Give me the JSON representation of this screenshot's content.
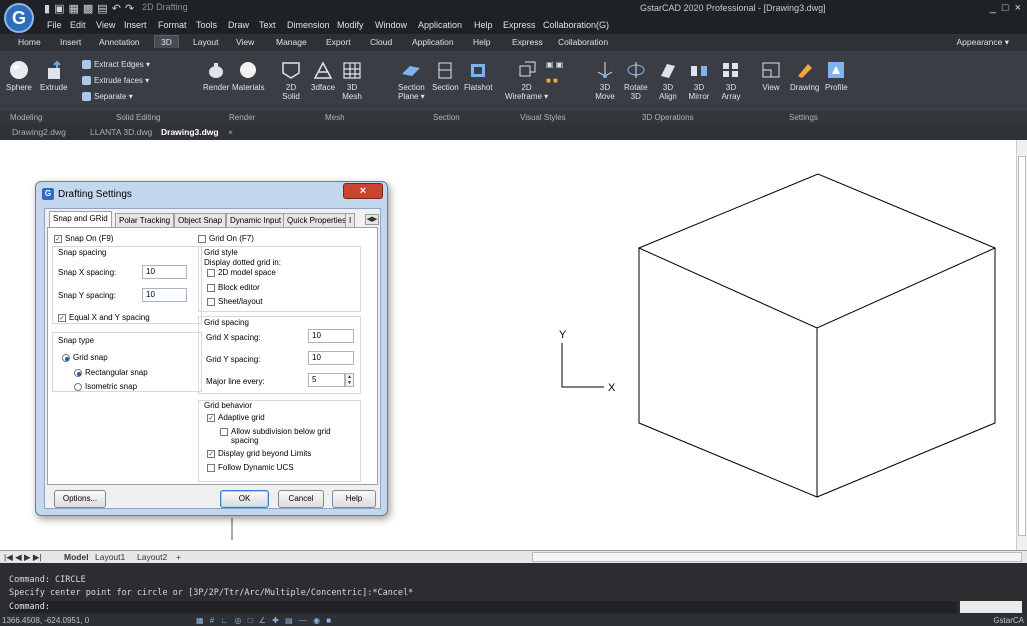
{
  "app": {
    "logo_letter": "G",
    "window_title": "GstarCAD 2020 Professional - [Drawing3.dwg]",
    "quick_access_label": "2D Drafting",
    "controls": [
      "_",
      "□",
      "×"
    ]
  },
  "menu": [
    "File",
    "Edit",
    "View",
    "Insert",
    "Format",
    "Tools",
    "Draw",
    "Text",
    "Dimension",
    "Modify",
    "Window",
    "Application",
    "Help",
    "Express",
    "Collaboration(G)"
  ],
  "ribbon_tabs": [
    "Home",
    "Insert",
    "Annotation",
    "3D",
    "Layout",
    "View",
    "Manage",
    "Export",
    "Cloud",
    "Application",
    "Help",
    "Express",
    "Collaboration"
  ],
  "active_ribbon_tab": "3D",
  "appearance_label": "Appearance ▾",
  "ribbon": {
    "modeling": {
      "sphere": "Sphere",
      "extrude": "Extrude",
      "label": "Modeling"
    },
    "solid_editing": {
      "extract_edges": "Extract Edges ▾",
      "extrude_faces": "Extrude faces ▾",
      "separate": "Separate ▾",
      "label": "Solid Editing"
    },
    "render": {
      "render": "Render",
      "materials": "Materials",
      "label": "Render"
    },
    "mesh": {
      "solid_2d_a": "2D",
      "solid_2d_b": "Solid",
      "3dface": "3dface",
      "mesh_a": "3D",
      "mesh_b": "Mesh",
      "label": "Mesh"
    },
    "section": {
      "section_plane_a": "Section",
      "section_plane_b": "Plane ▾",
      "section": "Section",
      "flatshot": "Flatshot",
      "label": "Section"
    },
    "visual_styles": {
      "wireframe_a": "2D",
      "wireframe_b": "Wireframe ▾",
      "label": "Visual Styles"
    },
    "operations_3d": {
      "move_a": "3D",
      "move_b": "Move",
      "rotate_a": "Rotate",
      "rotate_b": "3D",
      "align_a": "3D",
      "align_b": "Align",
      "mirror_a": "3D",
      "mirror_b": "Mirror",
      "array_a": "3D",
      "array_b": "Array",
      "label": "3D Operations"
    },
    "settings": {
      "view": "View",
      "drawing": "Drawing",
      "profile": "Profile",
      "label": "Settings"
    }
  },
  "doc_tabs": [
    "Drawing2.dwg",
    "LLANTA 3D.dwg",
    "Drawing3.dwg",
    "×"
  ],
  "ucs": {
    "x": "X",
    "y": "Y"
  },
  "layout_tabs": [
    "Model",
    "Layout1",
    "Layout2",
    "+"
  ],
  "command_lines": [
    "Command: CIRCLE",
    "Specify center point for circle or [3P/2P/Ttr/Arc/Multiple/Concentric]:*Cancel*"
  ],
  "command_prompt": "Command:",
  "status": {
    "coords": "1366.4508, -624.0951, 0",
    "right_label": "GstarCA"
  },
  "dialog": {
    "title": "Drafting Settings",
    "close": "×",
    "tabs": [
      "Snap and GRid",
      "Polar Tracking",
      "Object Snap",
      "Dynamic Input",
      "Quick Properties",
      "I"
    ],
    "snap_on": "Snap On (F9)",
    "snap_spacing": "Snap spacing",
    "snap_x_label": "Snap X spacing:",
    "snap_x_value": "10",
    "snap_y_label": "Snap Y spacing:",
    "snap_y_value": "10",
    "equal_xy": "Equal X and Y spacing",
    "snap_type": "Snap type",
    "grid_snap": "Grid snap",
    "rect_snap": "Rectangular snap",
    "iso_snap": "Isometric snap",
    "grid_on": "Grid On (F7)",
    "grid_style": "Grid style",
    "display_dotted": "Display dotted grid in:",
    "model_space": "2D model space",
    "block_editor": "Block editor",
    "sheet_layout": "Sheet/layout",
    "grid_spacing": "Grid spacing",
    "grid_x_label": "Grid X spacing:",
    "grid_x_value": "10",
    "grid_y_label": "Grid Y spacing:",
    "grid_y_value": "10",
    "major_label": "Major line every:",
    "major_value": "5",
    "grid_behavior": "Grid behavior",
    "adaptive": "Adaptive grid",
    "allow_sub_a": "Allow subdivision below grid",
    "allow_sub_b": "spacing",
    "beyond_limits": "Display grid beyond Limits",
    "follow_ucs": "Follow Dynamic UCS",
    "options": "Options...",
    "ok": "OK",
    "cancel": "Cancel",
    "help": "Help"
  }
}
